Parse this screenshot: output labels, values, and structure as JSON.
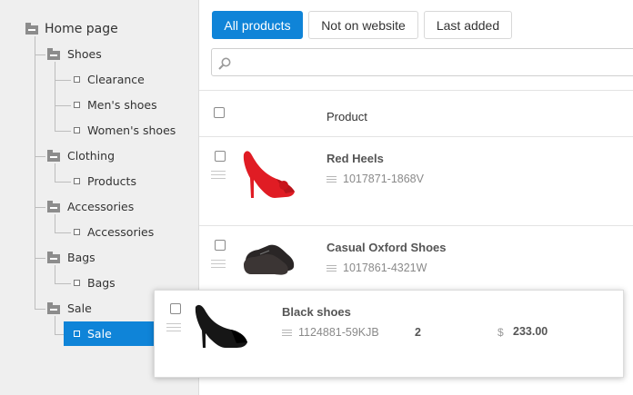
{
  "sidebar": {
    "root": "Home page",
    "categories": [
      {
        "label": "Shoes",
        "children": [
          "Clearance",
          "Men's shoes",
          "Women's shoes"
        ]
      },
      {
        "label": "Clothing",
        "children": [
          "Products"
        ]
      },
      {
        "label": "Accessories",
        "children": [
          "Accessories"
        ]
      },
      {
        "label": "Bags",
        "children": [
          "Bags"
        ]
      },
      {
        "label": "Sale",
        "children": [
          "Sale"
        ]
      }
    ],
    "selected": "Sale"
  },
  "filters": [
    "All products",
    "Not on website",
    "Last added"
  ],
  "active_filter": "All products",
  "search": {
    "placeholder": ""
  },
  "table": {
    "column_product": "Product"
  },
  "products": [
    {
      "name": "Red Heels",
      "sku": "1017871-1868V"
    },
    {
      "name": "Casual Oxford Shoes",
      "sku": "1017861-4321W"
    }
  ],
  "dragged": {
    "name": "Black shoes",
    "sku": "1124881-59KJB",
    "qty": "2",
    "currency": "$",
    "price": "233.00"
  },
  "colors": {
    "accent": "#0f84d8",
    "sidebar_bg": "#efefef"
  }
}
